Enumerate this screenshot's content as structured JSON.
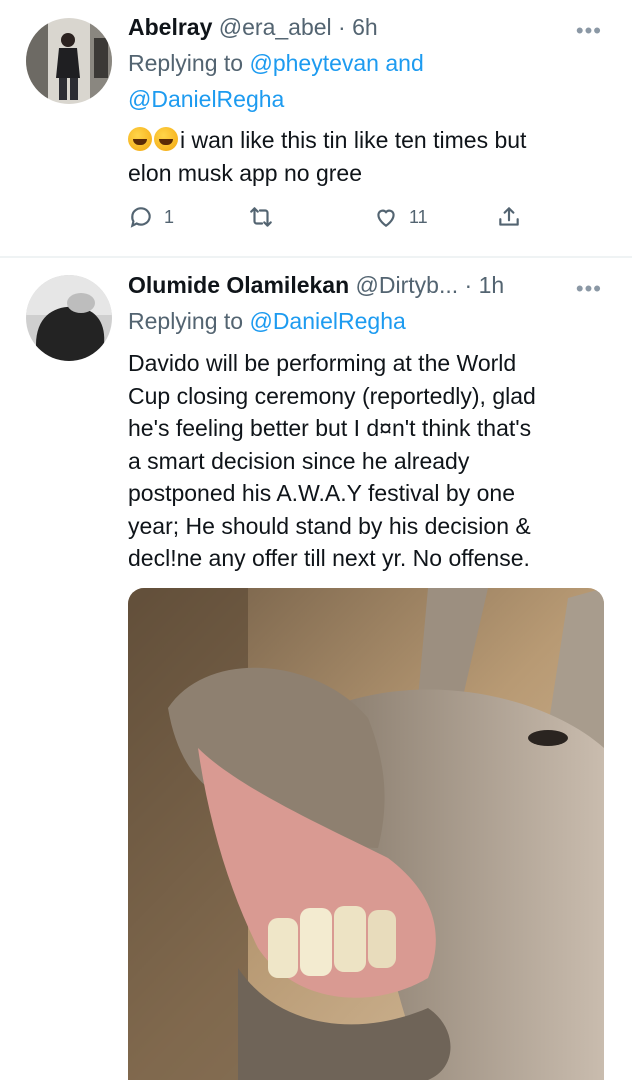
{
  "tweets": [
    {
      "name": "Abelray",
      "handle": "@era_abel",
      "time": "· 6h",
      "replying_prefix": "Replying to ",
      "mention_1": "@pheytevan",
      "and_word": " and",
      "mention_2": "@DanielRegha",
      "text_line1": "i wan like this tin like ten times but",
      "text_line2": "elon musk app no gree",
      "emoji": [
        "rofl-emoji",
        "rofl-emoji"
      ],
      "replies": "1",
      "likes": "11",
      "more": "•••"
    },
    {
      "name": "Olumide Olamilekan",
      "handle": "@Dirtyb...",
      "time": "· 1h",
      "replying_prefix": "Replying to ",
      "mention_1": "@DanielRegha",
      "text_lines": [
        "Davido will be performing at the World",
        "Cup closing ceremony (reportedly), glad",
        "he's feeling better but I d¤n't think that's",
        "a smart decision since he already",
        "postponed his A.W.A.Y festival by one",
        "year; He should stand by his decision &",
        "decl!ne any  offer till next yr. No offense."
      ],
      "image": "laughing-donkey-photo",
      "more": "•••"
    }
  ],
  "icons": [
    "reply-icon",
    "retweet-icon",
    "like-icon",
    "share-icon"
  ],
  "colors": {
    "mention": "#1d9bf0",
    "secondary": "#536471",
    "text": "#0f1419"
  }
}
